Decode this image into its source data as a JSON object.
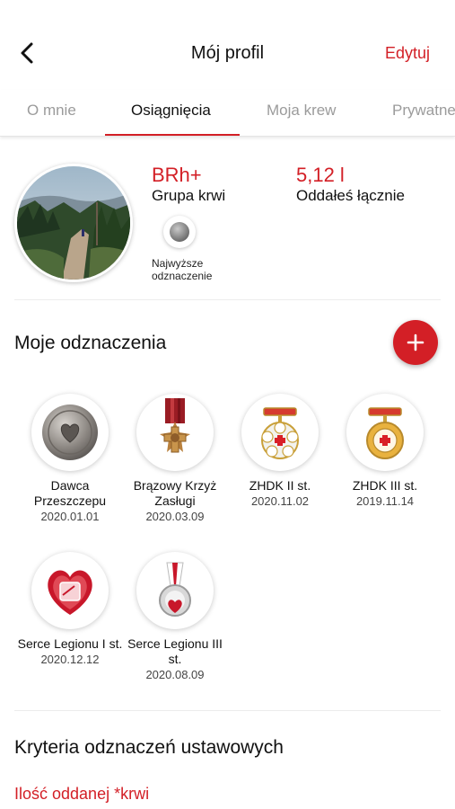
{
  "header": {
    "title": "Mój profil",
    "edit_label": "Edytuj"
  },
  "tabs": [
    {
      "label": "O mnie",
      "active": false
    },
    {
      "label": "Osiągnięcia",
      "active": true
    },
    {
      "label": "Moja krew",
      "active": false
    },
    {
      "label": "Prywatne",
      "active": false
    }
  ],
  "profile": {
    "blood_group_value": "BRh+",
    "blood_group_label": "Grupa krwi",
    "donated_value": "5,12 l",
    "donated_label": "Oddałeś łącznie",
    "top_badge_label": "Najwyższe odznaczenie"
  },
  "badges_section": {
    "title": "Moje odznaczenia",
    "add_icon": "plus-icon",
    "items": [
      {
        "name": "Dawca Przeszczepu",
        "date": "2020.01.01",
        "icon": "heart-coin-badge-icon"
      },
      {
        "name": "Brązowy Krzyż Zasługi",
        "date": "2020.03.09",
        "icon": "bronze-cross-medal-icon"
      },
      {
        "name": "ZHDK II st.",
        "date": "2020.11.02",
        "icon": "zhdk-medal-icon"
      },
      {
        "name": "ZHDK III st.",
        "date": "2019.11.14",
        "icon": "zhdk-medal-icon"
      },
      {
        "name": "Serce Legionu I st.",
        "date": "2020.12.12",
        "icon": "legion-heart-icon"
      },
      {
        "name": "Serce Legionu III st.",
        "date": "2020.08.09",
        "icon": "legion-heart-medal-icon"
      }
    ]
  },
  "criteria_section": {
    "title": "Kryteria odznaczeń ustawowych",
    "subtitle": "Ilość oddanej *krwi"
  },
  "colors": {
    "accent": "#d31f26",
    "text": "#111111",
    "muted": "#9b9b9b"
  }
}
